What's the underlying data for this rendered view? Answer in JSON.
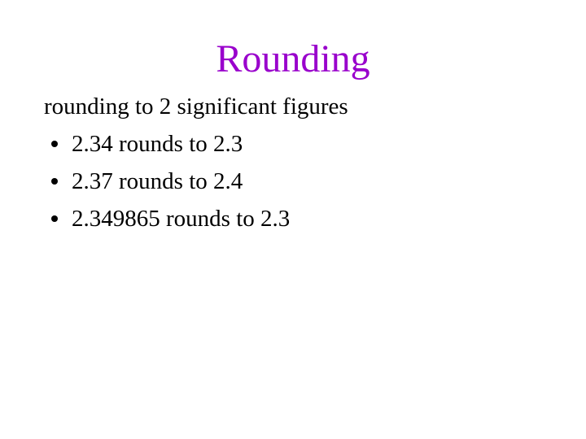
{
  "slide": {
    "title": "Rounding",
    "title_color": "#9900cc",
    "background_color": "#ffffff",
    "body_text_color": "#000000",
    "lead_line": "rounding to 2 significant figures",
    "bullets": [
      {
        "marker": "bullet-dot-icon",
        "text": "2.34 rounds to 2.3"
      },
      {
        "marker": "bullet-dot-icon",
        "text": "2.37 rounds to 2.4"
      },
      {
        "marker": "bullet-dot-icon",
        "text": "2.349865 rounds to 2.3"
      }
    ]
  }
}
